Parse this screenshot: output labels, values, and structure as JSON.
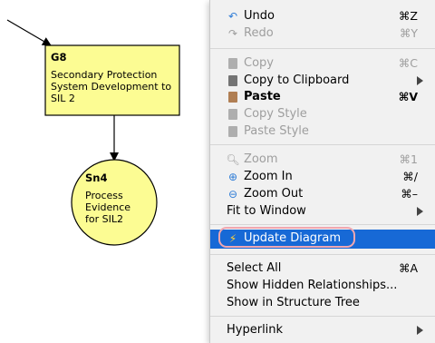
{
  "diagram": {
    "goal": {
      "id": "G8",
      "text": [
        "Secondary Protection",
        "System Development to",
        "SIL 2"
      ]
    },
    "solution": {
      "id": "Sn4",
      "text": [
        "Process",
        "Evidence",
        "for SIL2"
      ]
    },
    "colors": {
      "node_fill": "#fcfc93",
      "outline": "#000000"
    }
  },
  "menu": {
    "undo": {
      "label": "Undo",
      "shortcut": "⌘Z",
      "icon": "undo-icon"
    },
    "redo": {
      "label": "Redo",
      "shortcut": "⌘Y",
      "icon": "redo-icon"
    },
    "copy": {
      "label": "Copy",
      "shortcut": "⌘C",
      "icon": "copy-icon"
    },
    "copy_clipboard": {
      "label": "Copy to Clipboard",
      "icon": "clipboard-icon"
    },
    "paste": {
      "label": "Paste",
      "shortcut": "⌘V",
      "icon": "paste-icon"
    },
    "copy_style": {
      "label": "Copy Style",
      "icon": "copy-style-icon"
    },
    "paste_style": {
      "label": "Paste Style",
      "icon": "paste-style-icon"
    },
    "zoom": {
      "label": "Zoom",
      "shortcut": "⌘1",
      "icon": "zoom-icon"
    },
    "zoom_in": {
      "label": "Zoom In",
      "shortcut": "⌘/",
      "icon": "zoom-in-icon"
    },
    "zoom_out": {
      "label": "Zoom Out",
      "shortcut": "⌘–",
      "icon": "zoom-out-icon"
    },
    "fit_window": {
      "label": "Fit to Window"
    },
    "update_diagram": {
      "label": "Update Diagram",
      "icon": "lightning-icon"
    },
    "select_all": {
      "label": "Select All",
      "shortcut": "⌘A"
    },
    "show_hidden": {
      "label": "Show Hidden Relationships..."
    },
    "show_structure": {
      "label": "Show in Structure Tree"
    },
    "hyperlink": {
      "label": "Hyperlink"
    },
    "colors": {
      "selected_bg": "#1769d6",
      "highlight_ring": "#f0a7b0"
    }
  }
}
